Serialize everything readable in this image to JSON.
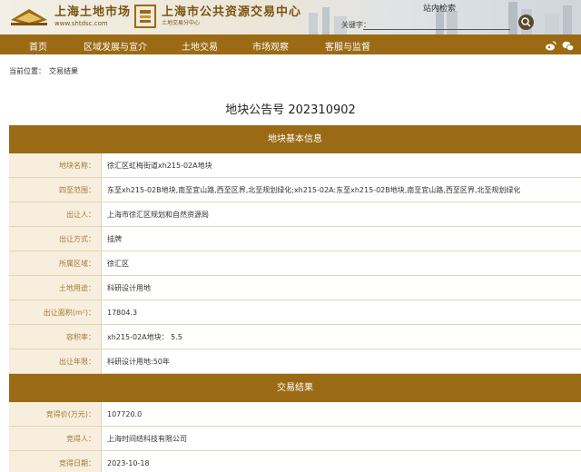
{
  "header": {
    "site1_name": "上海土地市场",
    "site1_url": "www.shtdsc.com",
    "site2_name": "上海市公共资源交易中心",
    "site2_sub": "土地交易分中心",
    "search_title": "站内检索",
    "search_label": "关键字：",
    "search_placeholder": ""
  },
  "nav": {
    "items": [
      "首页",
      "区域发展与宣介",
      "土地交易",
      "市场观察",
      "客服与监督"
    ],
    "icons": [
      "weibo-icon",
      "wechat-icon"
    ]
  },
  "breadcrumb": {
    "prefix": "当前位置：",
    "current": "交易结果"
  },
  "notice": {
    "title": "地块公告号 202310902"
  },
  "basic_info": {
    "heading": "地块基本信息",
    "rows": [
      {
        "label": "地块名称：",
        "value": "徐汇区虹梅街道xh215-02A地块"
      },
      {
        "label": "四至范围：",
        "value": "东至xh215-02B地块,南至宜山路,西至区界,北至规划绿化;xh215-02A:东至xh215-02B地块,南至宜山路,西至区界,北至规划绿化"
      },
      {
        "label": "出让人：",
        "value": "上海市徐汇区规划和自然资源局"
      },
      {
        "label": "出让方式：",
        "value": "挂牌"
      },
      {
        "label": "所属区域：",
        "value": "徐汇区"
      },
      {
        "label": "土地用途：",
        "value": "科研设计用地"
      },
      {
        "label": "出让面积(m²)：",
        "value": "17804.3"
      },
      {
        "label": "容积率：",
        "value": "xh215-02A地块： 5.5"
      },
      {
        "label": "出让年限：",
        "value": "科研设计用地:50年"
      }
    ]
  },
  "result": {
    "heading": "交易结果",
    "rows": [
      {
        "label": "竞得价(万元)：",
        "value": "107720.0"
      },
      {
        "label": "竞得人：",
        "value": "上海时间结科技有限公司"
      },
      {
        "label": "竞得日期：",
        "value": "2023-10-18"
      }
    ]
  },
  "colors": {
    "brand_brown": "#9b6a14",
    "label_bg": "#f8eedd",
    "label_text": "#a07a3a"
  }
}
